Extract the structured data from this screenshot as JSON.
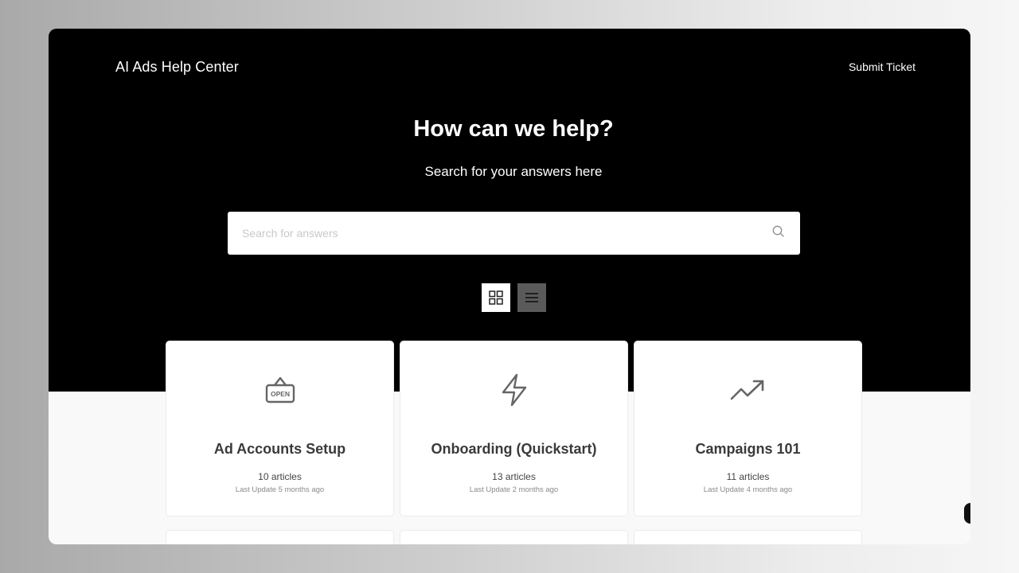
{
  "header": {
    "brand": "AI Ads Help Center",
    "submit_ticket": "Submit Ticket"
  },
  "hero": {
    "title": "How can we help?",
    "subtitle": "Search for your answers here"
  },
  "search": {
    "placeholder": "Search for answers",
    "value": "",
    "icon": "search-icon"
  },
  "view_toggle": {
    "selected": "grid",
    "grid_icon": "grid-view-icon",
    "list_icon": "list-view-icon"
  },
  "categories": [
    {
      "icon": "open-sign-icon",
      "icon_text": "OPEN",
      "title": "Ad Accounts Setup",
      "articles": "10 articles",
      "updated": "Last Update 5 months ago"
    },
    {
      "icon": "lightning-bolt-icon",
      "title": "Onboarding (Quickstart)",
      "articles": "13 articles",
      "updated": "Last Update 2 months ago"
    },
    {
      "icon": "trending-up-icon",
      "title": "Campaigns 101",
      "articles": "11 articles",
      "updated": "Last Update 4 months ago"
    }
  ],
  "colors": {
    "hero_background": "#000000",
    "page_background": "#f9f9f9",
    "card_background": "#ffffff",
    "icon_gray": "#666666",
    "active_toggle": "#ffffff",
    "inactive_toggle": "#5a5a5a"
  }
}
